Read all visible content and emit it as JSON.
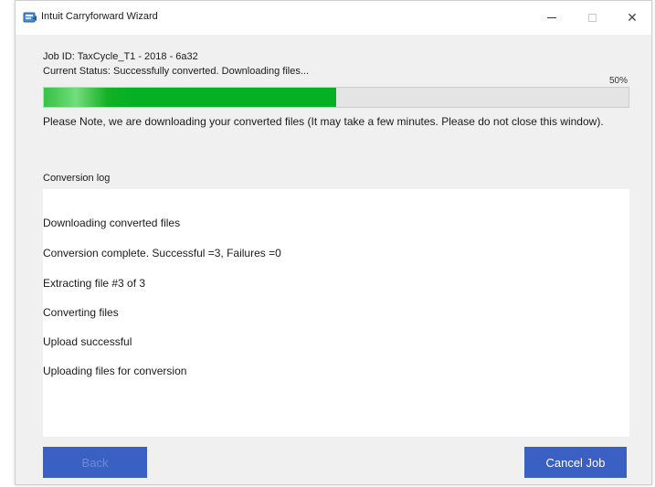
{
  "window": {
    "title": "Intuit Carryforward Wizard",
    "app_icon": "carryforward-app-icon",
    "controls": {
      "minimize_icon": "minimize-icon",
      "maximize_icon": "maximize-icon",
      "close_icon": "close-icon",
      "close_glyph": "✕"
    }
  },
  "job": {
    "id_text": "Job ID:  TaxCycle_T1 - 2018 - 6a32",
    "status_text": "Current Status: Successfully converted. Downloading files..."
  },
  "progress": {
    "percent_label": "50%",
    "fraction": 0.5,
    "fill_color": "#06b025"
  },
  "note": "Please Note, we are downloading your converted files (It may take a few minutes. Please do not close this window).",
  "log": {
    "label": "Conversion log",
    "lines": [
      "Downloading converted files",
      "Conversion complete. Successful =3, Failures =0",
      " Extracting file #3 of 3",
      "Converting files",
      "Upload successful",
      "Uploading files for conversion"
    ]
  },
  "buttons": {
    "back_label": "Back",
    "cancel_label": "Cancel Job",
    "accent_color": "#3a60c4"
  }
}
